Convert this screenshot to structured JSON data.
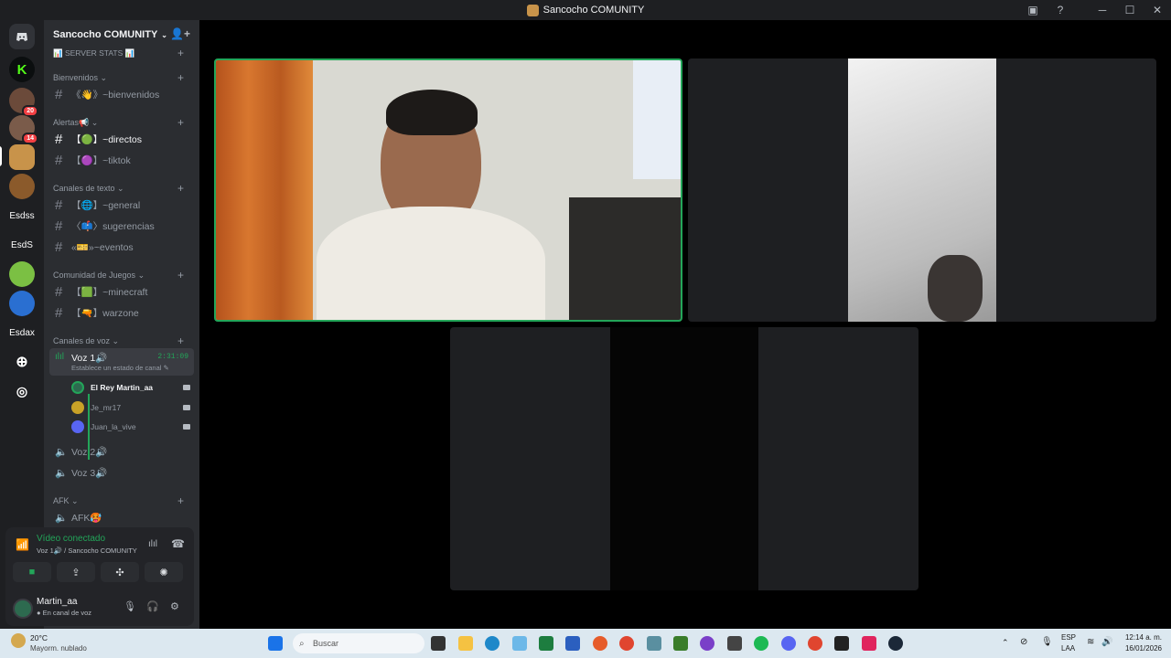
{
  "window": {
    "title": "Sancocho COMUNITY"
  },
  "servers": [
    {
      "name": "kick",
      "abbr": "K",
      "color": "#53fc18"
    },
    {
      "name": "server-20",
      "abbr": "",
      "color": "#6b4a3a",
      "badge": "20"
    },
    {
      "name": "server-14",
      "abbr": "",
      "color": "#7a5b4a",
      "badge": "14"
    },
    {
      "name": "sancocho",
      "abbr": "",
      "color": "#c8934a"
    },
    {
      "name": "server-food",
      "abbr": "",
      "color": "#8b5a2b"
    },
    {
      "name": "Esdss",
      "abbr": "Esdss"
    },
    {
      "name": "EsdS",
      "abbr": "EsdS"
    },
    {
      "name": "server-green",
      "abbr": "",
      "color": "#7bc043"
    },
    {
      "name": "server-blue",
      "abbr": "",
      "color": "#2a6fd1"
    },
    {
      "name": "Esdax",
      "abbr": "Esdax"
    }
  ],
  "sidebar": {
    "server_name": "Sancocho COMUNITY",
    "server_stats": "📊 SERVER STATS 📊",
    "categories": [
      {
        "name": "Bienvenidos"
      },
      {
        "name": "Alertas📢"
      },
      {
        "name": "Canales de texto"
      },
      {
        "name": "Comunidad de Juegos"
      },
      {
        "name": "Canales de voz"
      },
      {
        "name": "AFK"
      }
    ],
    "channels": [
      {
        "name": "《👋》~bienvenidos"
      },
      {
        "name": "【🟢】~directos"
      },
      {
        "name": "【🟣】~tiktok"
      },
      {
        "name": "【🌐】~general"
      },
      {
        "name": "〈📫〉sugerencias"
      },
      {
        "name": "«🎫»~eventos"
      },
      {
        "name": "【🟩】~minecraft"
      },
      {
        "name": "【🔫】warzone"
      }
    ],
    "voice": {
      "active": {
        "name": "Voz 1🔊",
        "time": "2:31:09",
        "status": "Establece un estado de canal"
      },
      "users": [
        {
          "name": "El Rey Martin_aa",
          "color": "#2d6a4f"
        },
        {
          "name": "Je_mr17",
          "color": "#c9a227"
        },
        {
          "name": "Juan_la_vive",
          "color": "#5865f2"
        }
      ],
      "others": [
        "Voz 2🔊",
        "Voz 3🔊"
      ],
      "afk": "AFK🥵"
    }
  },
  "panel": {
    "status_title": "Vídeo conectado",
    "status_sub": "Voz 1🔊 / Sancocho COMUNITY",
    "username": "Martin_aa",
    "user_status": "En canal de voz"
  },
  "taskbar": {
    "weather_temp": "20°C",
    "weather_desc": "Mayorm. nublado",
    "search_placeholder": "Buscar",
    "lang_1": "ESP",
    "lang_2": "LAA",
    "time": "12:14 a. m.",
    "date": "16/01/2026"
  },
  "colors": {
    "accent_green": "#23a559",
    "sidebar_bg": "#2b2d31",
    "rail_bg": "#1e1f22"
  }
}
